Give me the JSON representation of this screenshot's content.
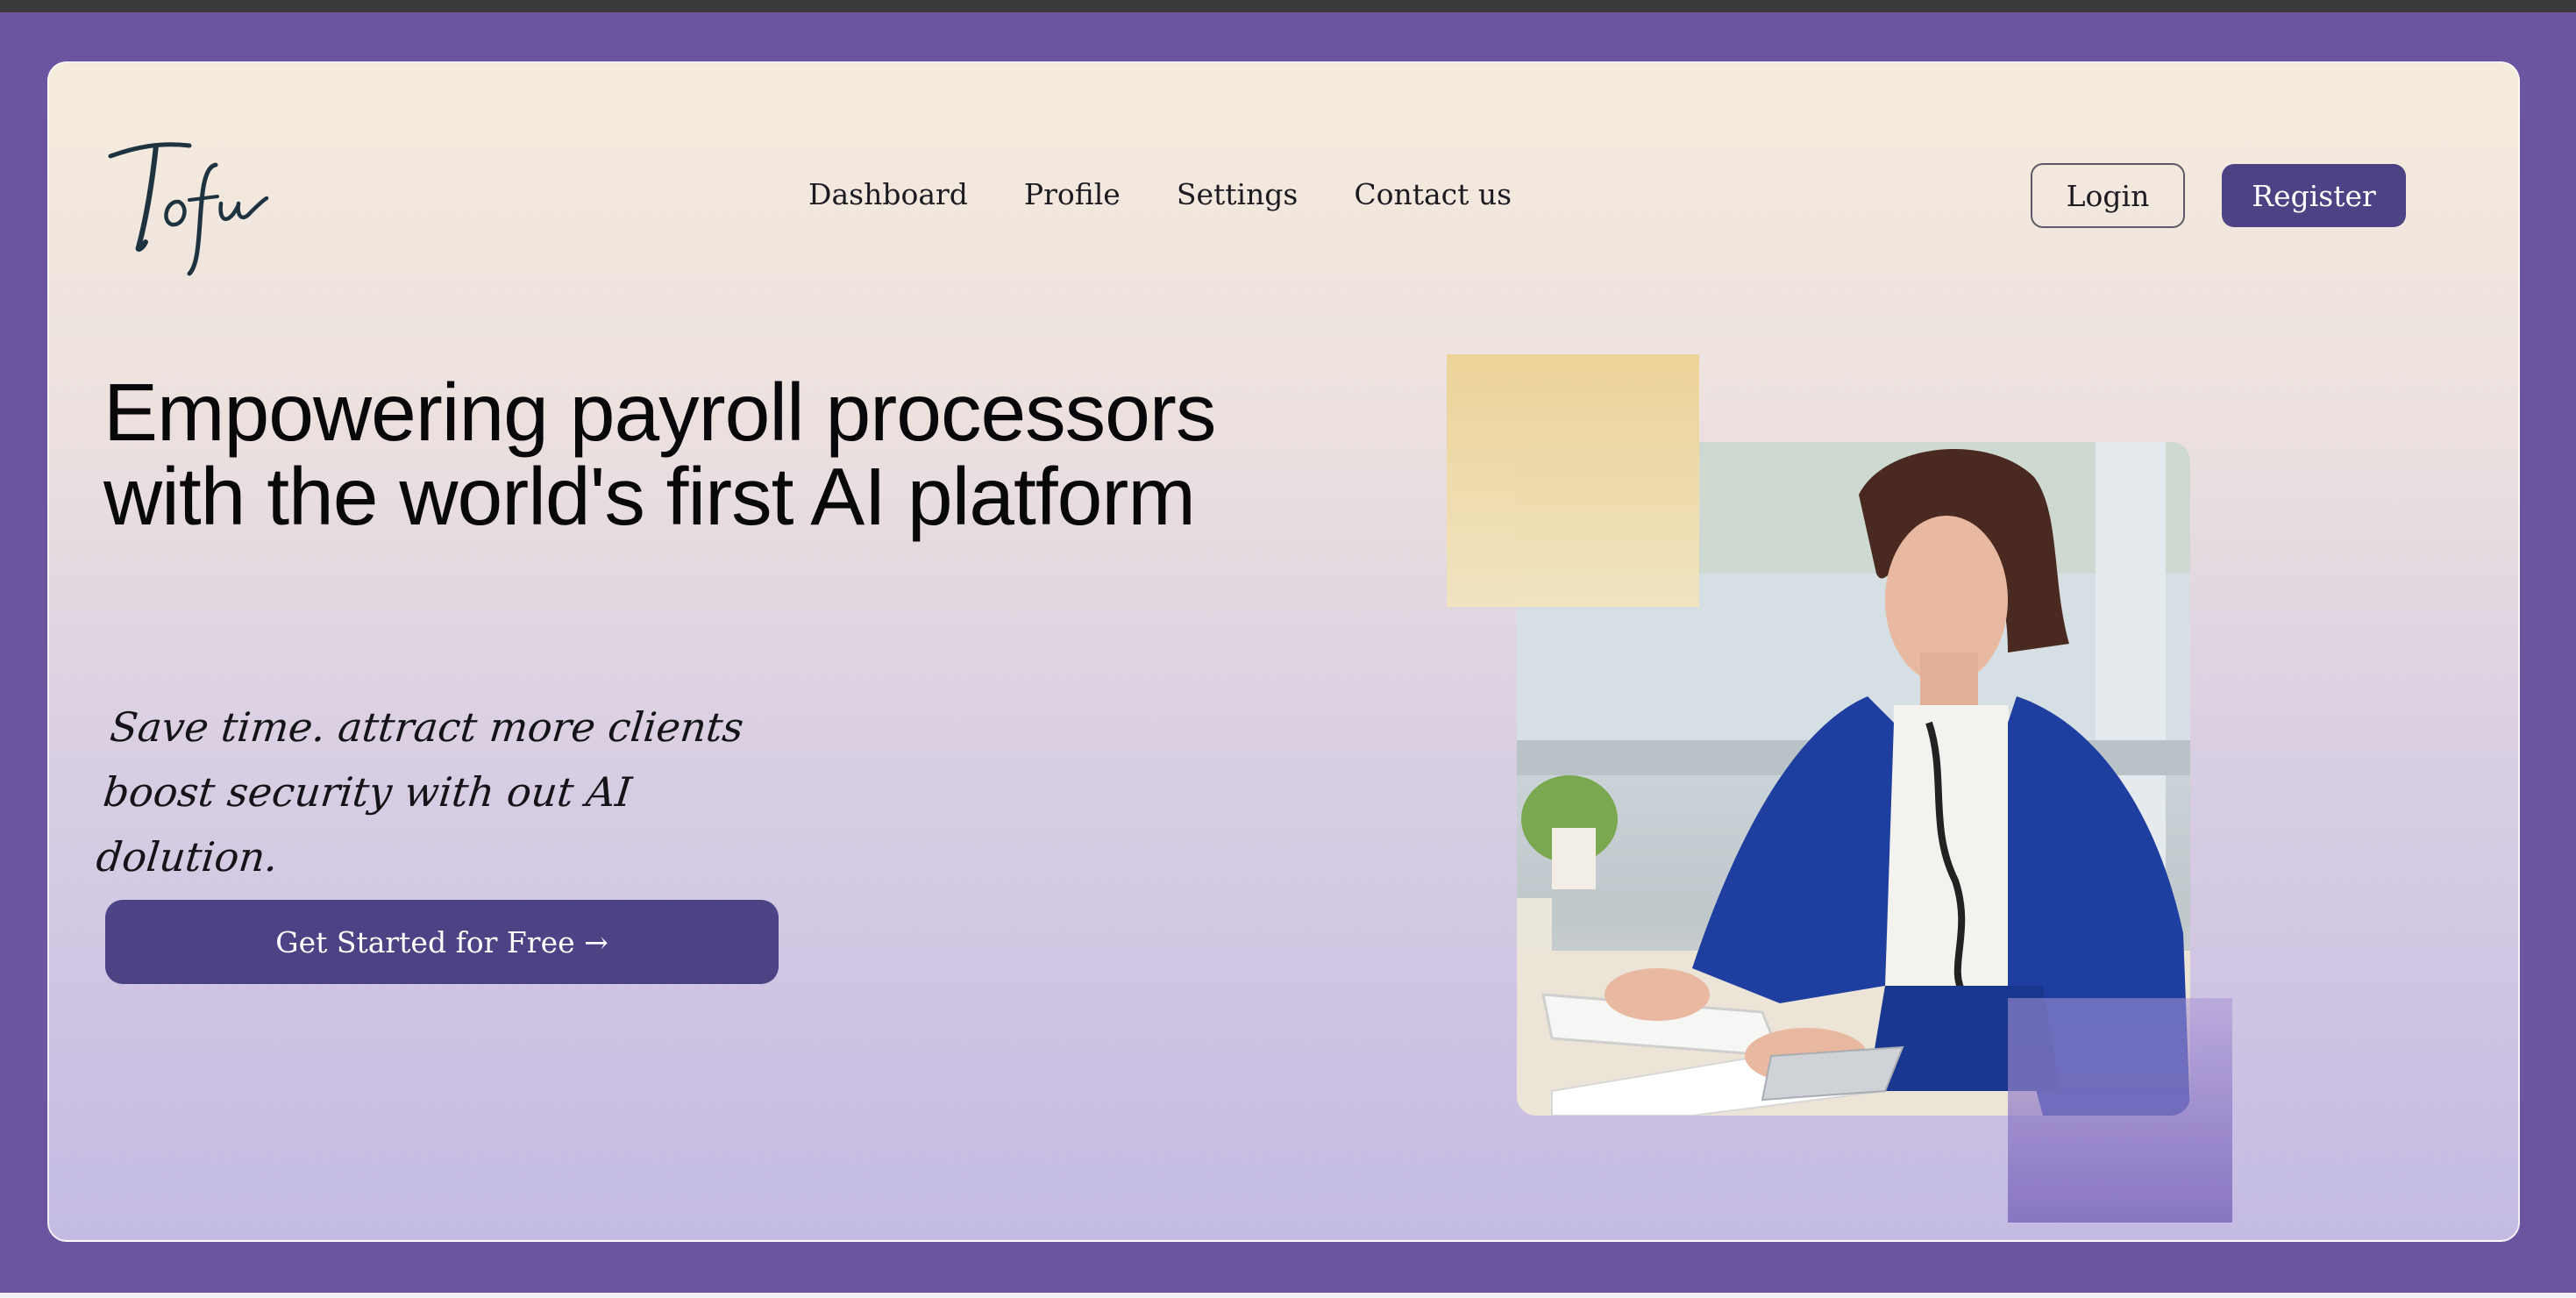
{
  "brand": {
    "logo_text": "Tofu"
  },
  "nav": {
    "items": [
      {
        "label": "Dashboard"
      },
      {
        "label": "Profile"
      },
      {
        "label": "Settings"
      },
      {
        "label": "Contact us"
      }
    ]
  },
  "auth": {
    "login_label": "Login",
    "register_label": "Register"
  },
  "hero": {
    "headline": "Empowering payroll processors with the world's first AI platform",
    "tagline": "Save time. attract more clients boost security with out AI dolution.",
    "cta_label": "Get Started for Free →"
  },
  "colors": {
    "page_background": "#6b55a0",
    "primary_button": "#4c4385",
    "accent_gold": "#ecd296",
    "accent_lavender": "#8e7cc8",
    "text": "#08080a"
  }
}
